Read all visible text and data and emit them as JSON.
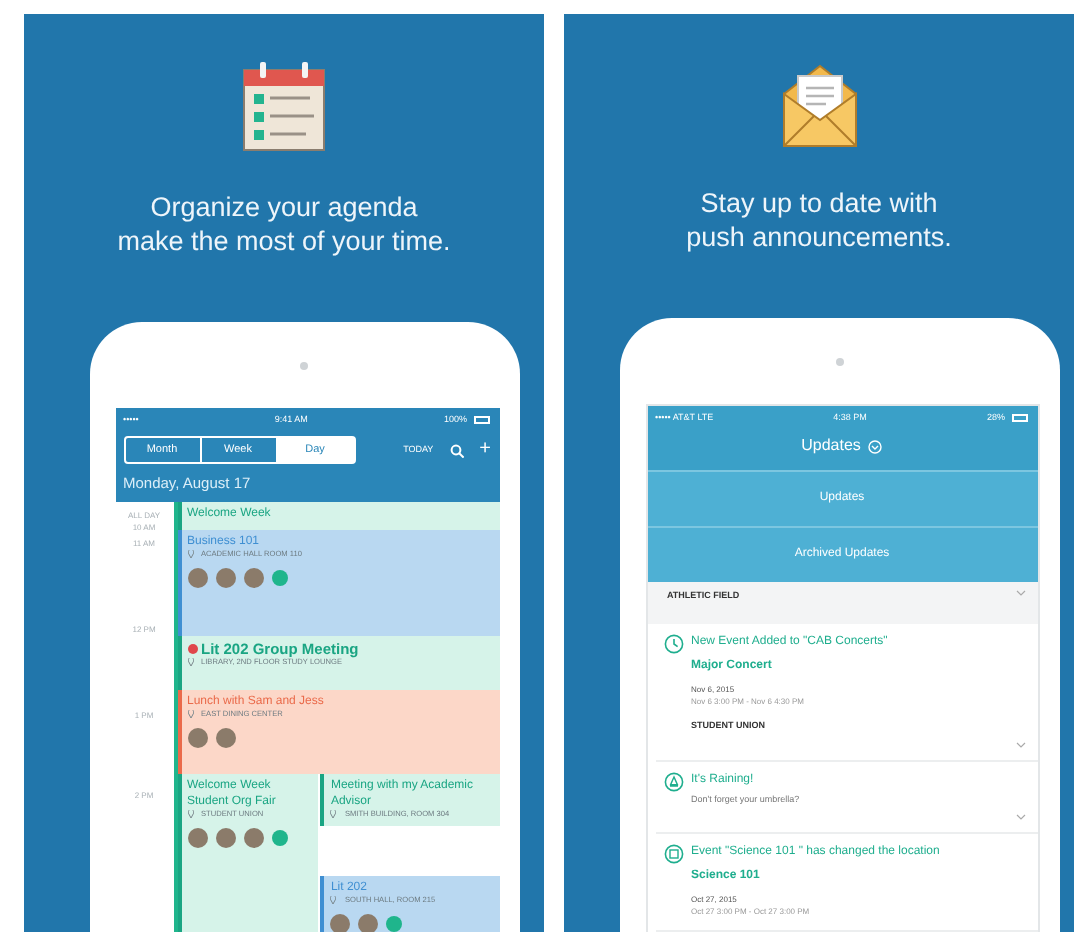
{
  "agenda_panel": {
    "caption_lines": [
      "Organize your agenda",
      "make the most of your time."
    ],
    "status_bar": {
      "carrier": "•••••",
      "time": "9:41 AM",
      "battery": "100%"
    },
    "tabs": [
      {
        "label": "Month",
        "selected": false
      },
      {
        "label": "Week",
        "selected": false
      },
      {
        "label": "Day",
        "selected": true
      }
    ],
    "today": "TODAY",
    "plus": "+",
    "date": "Monday, August 17",
    "times": [
      "ALL DAY",
      "10 AM",
      "11 AM",
      "12 PM",
      "1 PM",
      "2 PM"
    ],
    "event_rows": [
      {
        "events": [
          {
            "title": "Welcome Week",
            "color": "#1aa583",
            "bold": false
          }
        ]
      },
      {
        "events": [
          {
            "title": "Business 101",
            "location": "ACADEMIC HALL ROOM 110",
            "color": "#3f8fd2",
            "bold": false,
            "attendees": [
              {
                "kind": "person"
              },
              {
                "kind": "person"
              },
              {
                "kind": "person"
              },
              {
                "kind": "more"
              }
            ]
          }
        ]
      },
      {
        "events": [
          {
            "title": "Lit 202 Group Meeting",
            "location": "LIBRARY, 2ND FLOOR STUDY LOUNGE",
            "color": "#1aa583",
            "bold": true,
            "status": {
              "color": "#e0474c"
            }
          }
        ]
      },
      {
        "events": [
          {
            "title": "Lunch with Sam and Jess",
            "location": "EAST DINING CENTER",
            "color": "#ea6a4a",
            "bold": false,
            "attendees": [
              {
                "kind": "person"
              },
              {
                "kind": "person"
              }
            ]
          }
        ]
      },
      {
        "events": [
          {
            "title": "Welcome Week Student Org Fair",
            "location": "STUDENT UNION",
            "color": "#1aa583",
            "bold": false,
            "attendees": [
              {
                "kind": "person"
              },
              {
                "kind": "person"
              },
              {
                "kind": "person"
              },
              {
                "kind": "more"
              }
            ]
          },
          {
            "title": "Meeting with my Academic Advisor",
            "location": "SMITH BUILDING, ROOM 304",
            "color": "#1aa583",
            "bold": false
          },
          {
            "title": "Lit 202",
            "location": "SOUTH HALL, ROOM 215",
            "color": "#3f8fd2",
            "bold": false,
            "attendees": [
              {
                "kind": "person"
              },
              {
                "kind": "person"
              },
              {
                "kind": "more"
              }
            ]
          }
        ]
      }
    ]
  },
  "updates_panel": {
    "caption_lines": [
      "Stay up to date with",
      "push announcements."
    ],
    "status_bar": {
      "carrier": "••••• AT&T  LTE",
      "time": "4:38 PM",
      "battery": "28%"
    },
    "title": "Updates",
    "menu": [
      "Updates",
      "Archived Updates"
    ],
    "location_tail": "ATHLETIC FIELD",
    "updates": [
      {
        "kind": "event",
        "headline": "New Event Added to \"CAB Concerts\"",
        "name": "Major Concert",
        "date": "Nov 6, 2015",
        "time": "Nov 6 3:00 PM - Nov 6 4:30 PM",
        "location": "STUDENT UNION"
      },
      {
        "kind": "alert",
        "headline": "It's Raining!",
        "message": "Don't forget your umbrella?"
      },
      {
        "kind": "location",
        "headline": "Event \"Science 101 \" has changed the location",
        "name": "Science 101",
        "date": "Oct 27, 2015",
        "time": "Oct 27 3:00 PM - Oct 27 3:00 PM"
      }
    ]
  }
}
